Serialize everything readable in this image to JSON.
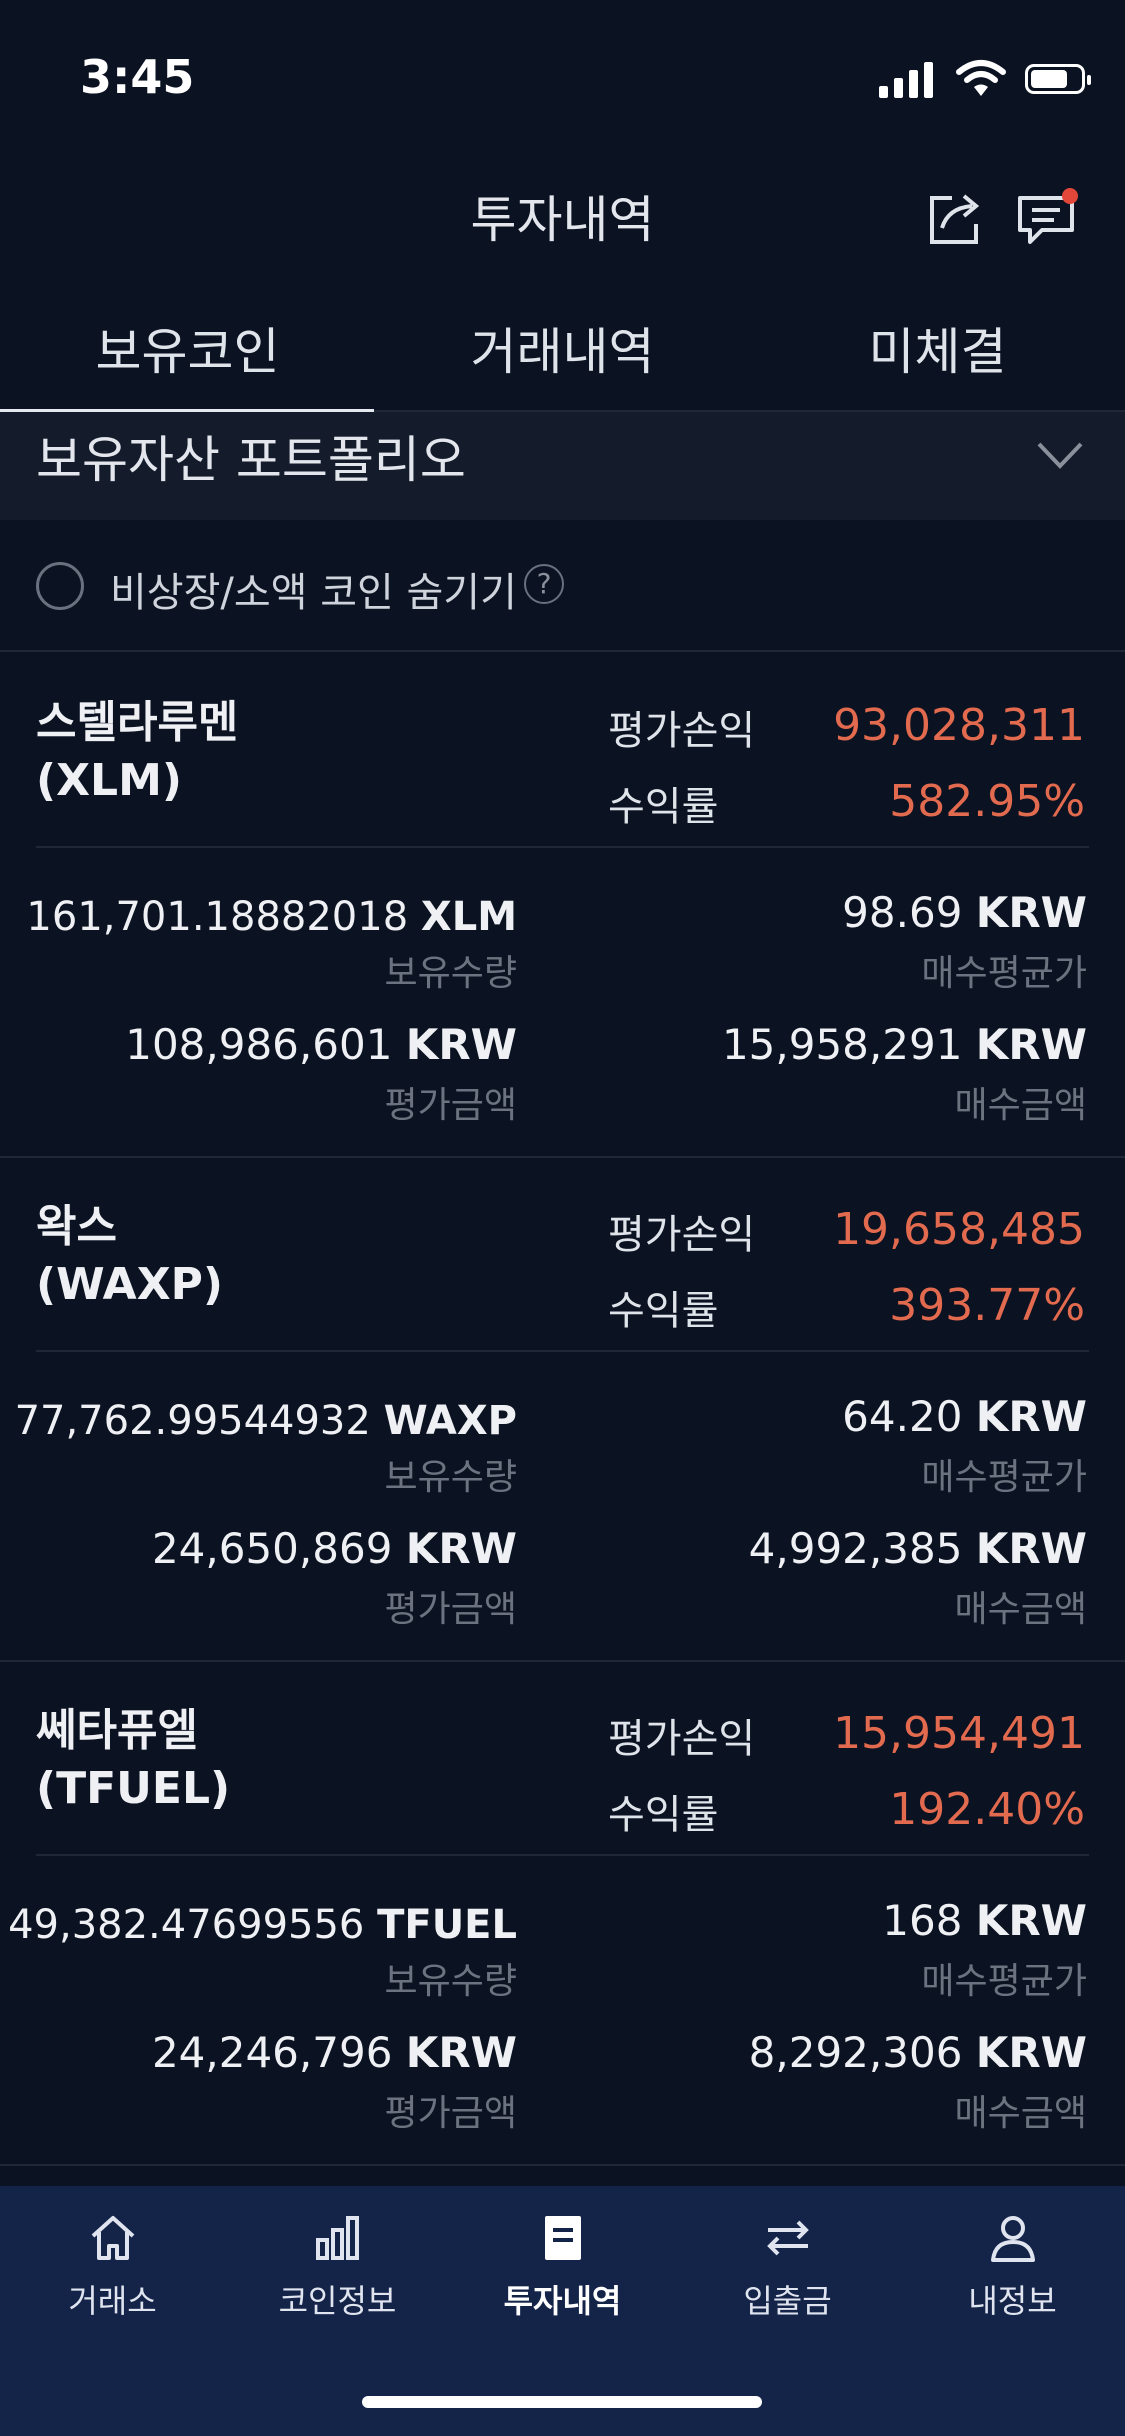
{
  "status": {
    "time": "3:45"
  },
  "header": {
    "title": "투자내역"
  },
  "tabs": [
    {
      "label": "보유코인",
      "active": true
    },
    {
      "label": "거래내역",
      "active": false
    },
    {
      "label": "미체결",
      "active": false
    }
  ],
  "portfolio": {
    "title": "보유자산 포트폴리오"
  },
  "filter": {
    "hide_label": "비상장/소액 코인 숨기기",
    "help": "?"
  },
  "labels": {
    "pl": "평가손익",
    "rate": "수익률",
    "holding_qty": "보유수량",
    "avg_price": "매수평균가",
    "eval_amount": "평가금액",
    "buy_amount": "매수금액",
    "krw": "KRW"
  },
  "coins": [
    {
      "name": "스텔라루멘",
      "symbol": "(XLM)",
      "ticker": "XLM",
      "pl": "93,028,311",
      "rate": "582.95%",
      "qty": "161,701.18882018",
      "avg_price": "98.69",
      "eval_amount": "108,986,601",
      "buy_amount": "15,958,291"
    },
    {
      "name": "왁스",
      "symbol": "(WAXP)",
      "ticker": "WAXP",
      "pl": "19,658,485",
      "rate": "393.77%",
      "qty": "77,762.99544932",
      "avg_price": "64.20",
      "eval_amount": "24,650,869",
      "buy_amount": "4,992,385"
    },
    {
      "name": "쎄타퓨엘",
      "symbol": "(TFUEL)",
      "ticker": "TFUEL",
      "pl": "15,954,491",
      "rate": "192.40%",
      "qty": "49,382.47699556",
      "avg_price": "168",
      "eval_amount": "24,246,796",
      "buy_amount": "8,292,306"
    }
  ],
  "nav": [
    {
      "label": "거래소",
      "icon": "home-icon"
    },
    {
      "label": "코인정보",
      "icon": "chart-icon"
    },
    {
      "label": "투자내역",
      "icon": "document-icon",
      "active": true
    },
    {
      "label": "입출금",
      "icon": "transfer-icon"
    },
    {
      "label": "내정보",
      "icon": "person-icon"
    }
  ],
  "colors": {
    "profit": "#e26a4e",
    "background": "#0b1221",
    "nav": "#142449"
  }
}
